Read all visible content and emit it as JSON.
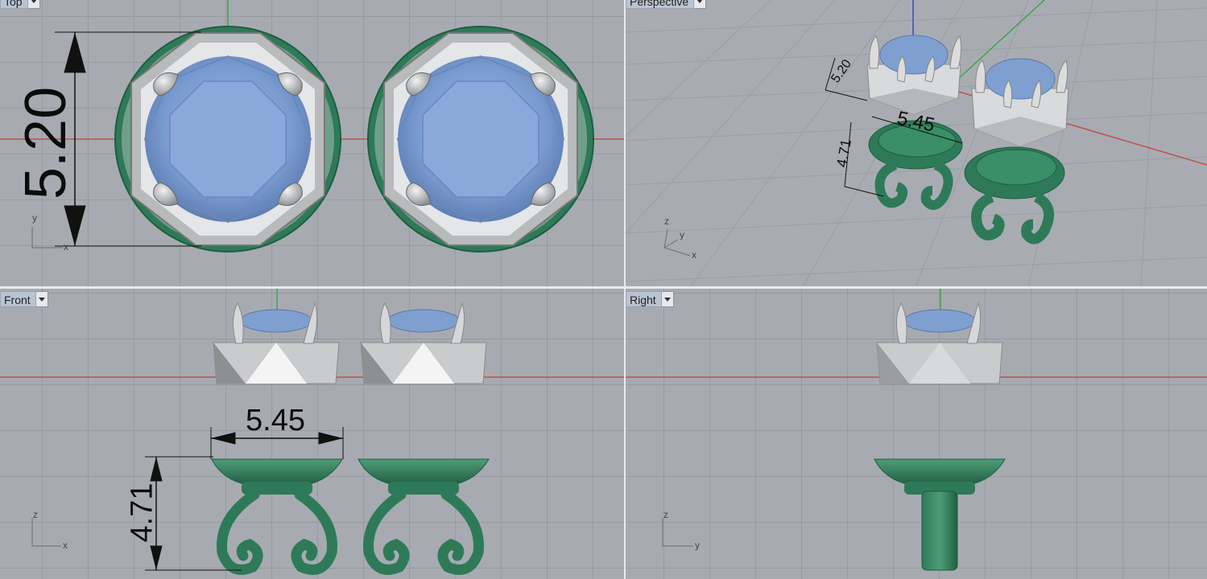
{
  "viewports": {
    "top": {
      "name": "Top",
      "dim_height": "5.20",
      "axis_x": "x",
      "axis_y": "y"
    },
    "perspective": {
      "name": "Perspective",
      "dim_a": "5.20",
      "dim_b": "5.45",
      "dim_c": "4.71",
      "axis_x": "x",
      "axis_y": "y",
      "axis_z": "z"
    },
    "front": {
      "name": "Front",
      "dim_width": "5.45",
      "dim_height": "4.71",
      "axis_x": "x",
      "axis_z": "z"
    },
    "right": {
      "name": "Right",
      "axis_y": "y",
      "axis_z": "z"
    }
  },
  "colors": {
    "metal_green": "#2e7a58",
    "gem_blue": "#7f9fd0",
    "prong_silver": "#cfd1d3",
    "x_axis": "#c0504d",
    "y_axis": "#3fa345",
    "z_axis": "#3b48c8"
  }
}
